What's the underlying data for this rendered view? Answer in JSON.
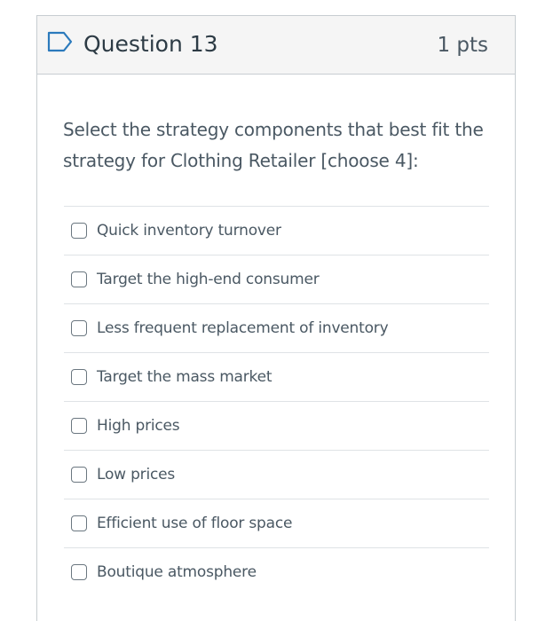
{
  "question": {
    "title": "Question 13",
    "points": "1 pts",
    "prompt": "Select the strategy components that best fit the strategy for Clothing Retailer [choose 4]:",
    "flag_icon": "flag-outline-icon"
  },
  "answers": [
    {
      "label": "Quick inventory turnover",
      "checked": false
    },
    {
      "label": "Target the high-end consumer",
      "checked": false
    },
    {
      "label": "Less frequent replacement of inventory",
      "checked": false
    },
    {
      "label": "Target the mass market",
      "checked": false
    },
    {
      "label": "High prices",
      "checked": false
    },
    {
      "label": "Low prices",
      "checked": false
    },
    {
      "label": "Efficient use of floor space",
      "checked": false
    },
    {
      "label": "Boutique atmosphere",
      "checked": false
    }
  ],
  "colors": {
    "accent": "#2b7abc",
    "header_bg": "#f5f5f5",
    "border": "#c7cdd1",
    "text": "#2d3b45",
    "muted_text": "#4a5863"
  }
}
